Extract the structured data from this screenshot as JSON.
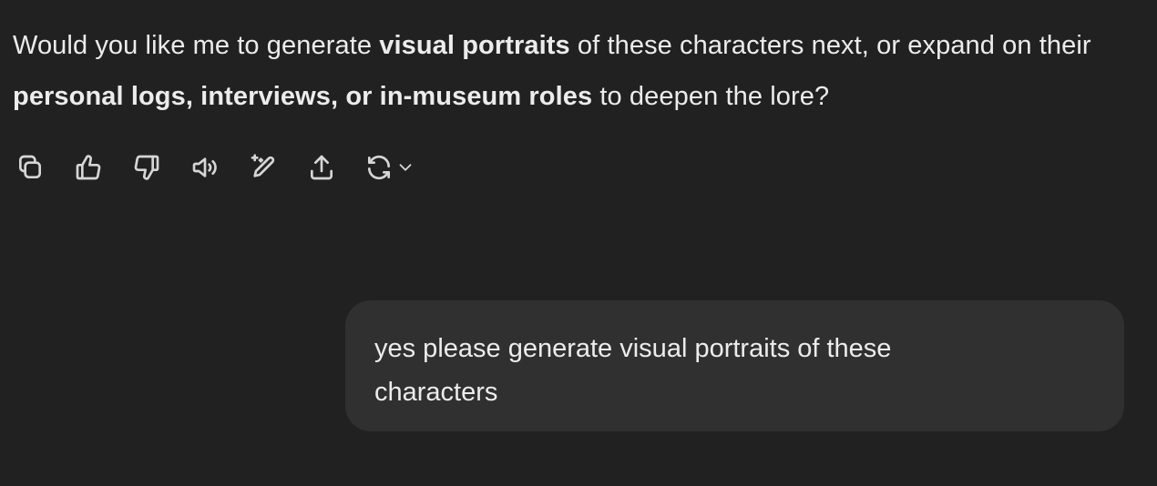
{
  "assistant": {
    "segments": [
      {
        "text": "Would you like me to generate ",
        "bold": false
      },
      {
        "text": "visual portraits",
        "bold": true
      },
      {
        "text": " of these characters next, or expand on their ",
        "bold": false
      },
      {
        "text": "personal logs, interviews, or in-museum roles",
        "bold": true
      },
      {
        "text": " to deepen the lore?",
        "bold": false
      }
    ]
  },
  "actions": [
    {
      "name": "copy-button",
      "icon": "copy-icon"
    },
    {
      "name": "thumbs-up-button",
      "icon": "thumbs-up-icon"
    },
    {
      "name": "thumbs-down-button",
      "icon": "thumbs-down-icon"
    },
    {
      "name": "read-aloud-button",
      "icon": "speaker-icon"
    },
    {
      "name": "edit-canvas-button",
      "icon": "pencil-sparkle-icon"
    },
    {
      "name": "share-button",
      "icon": "share-icon"
    },
    {
      "name": "regenerate-button",
      "icon": "refresh-icon"
    }
  ],
  "user": {
    "message": "yes please generate visual portraits of these characters"
  },
  "colors": {
    "background": "#212121",
    "bubble": "#303030",
    "text": "#ececec",
    "icon": "#d6d6d6"
  }
}
